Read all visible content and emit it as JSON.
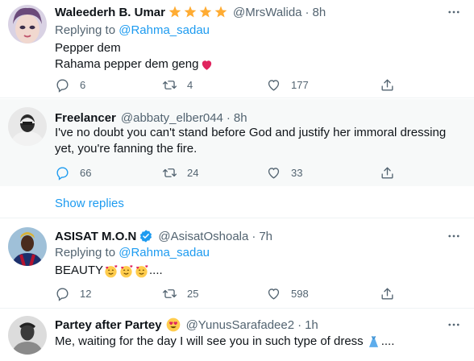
{
  "tweets": [
    {
      "name": "Waleederh B. Umar",
      "handle": "@MrsWalida",
      "dot": "·",
      "time": "8h",
      "replying_prefix": "Replying to ",
      "replying_to": "@Rahma_sadau",
      "lines": [
        "Pepper dem",
        "Rahama pepper dem geng"
      ],
      "replies": "6",
      "retweets": "4",
      "likes": "177"
    },
    {
      "name": "Freelancer",
      "handle": "@abbaty_elber044",
      "dot": "·",
      "time": "8h",
      "lines": [
        "I've no doubt you can't stand before God and justify her immoral dressing",
        "yet, you're fanning the fire."
      ],
      "replies": "66",
      "retweets": "24",
      "likes": "33"
    },
    {
      "name": "ASISAT M.O.N",
      "handle": "@AsisatOshoala",
      "dot": "·",
      "time": "7h",
      "replying_prefix": "Replying to ",
      "replying_to": "@Rahma_sadau",
      "lines": [
        "BEAUTY",
        "...."
      ],
      "replies": "12",
      "retweets": "25",
      "likes": "598"
    },
    {
      "name": "Partey after Partey",
      "handle": "@YunusSarafadee2",
      "dot": "·",
      "time": "1h",
      "lines": [
        "Me, waiting for the day I will see you in such type of dress",
        "...."
      ]
    }
  ],
  "show_replies": "Show replies",
  "colors": {
    "accent": "#1d9bf0",
    "secondary_text": "#536471",
    "heart_emoji": "#e0245e",
    "star_emoji": "#ffac33",
    "selected_background": "#f7f9f9"
  },
  "icons": [
    "reply-icon",
    "retweet-icon",
    "like-icon",
    "share-icon",
    "more-icon",
    "verified-badge-icon"
  ]
}
